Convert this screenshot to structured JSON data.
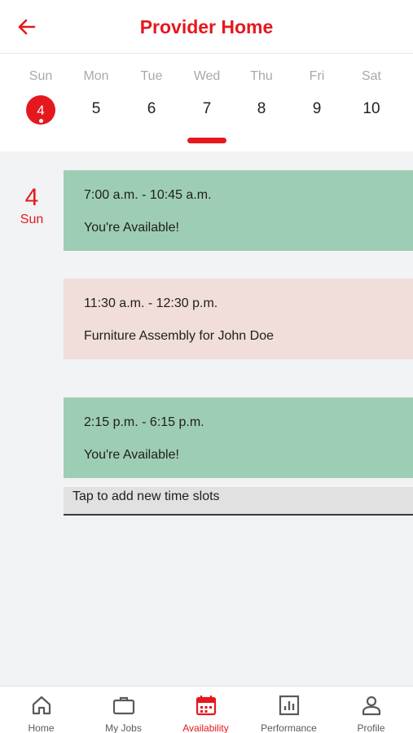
{
  "header": {
    "title": "Provider Home",
    "back_icon": "arrow-left-icon"
  },
  "week": {
    "days": [
      {
        "name": "Sun",
        "num": "4"
      },
      {
        "name": "Mon",
        "num": "5"
      },
      {
        "name": "Tue",
        "num": "6"
      },
      {
        "name": "Wed",
        "num": "7"
      },
      {
        "name": "Thu",
        "num": "8"
      },
      {
        "name": "Fri",
        "num": "9"
      },
      {
        "name": "Sat",
        "num": "10"
      }
    ],
    "selected_day": "Sun",
    "underlined_day": "Wed"
  },
  "schedule": {
    "date_num": "4",
    "date_day": "Sun",
    "slots": [
      {
        "time": "7:00 a.m. - 10:45 a.m.",
        "desc": "You're Available!",
        "status": "available"
      },
      {
        "time": "11:30 a.m. - 12:30 p.m.",
        "desc": "Furniture Assembly for John Doe",
        "status": "booked"
      },
      {
        "time": "2:15 p.m. - 6:15 p.m.",
        "desc": "You're Available!",
        "status": "available"
      }
    ],
    "add_label": "Tap to add new time slots"
  },
  "tabs": [
    {
      "label": "Home",
      "icon": "home-icon"
    },
    {
      "label": "My Jobs",
      "icon": "briefcase-icon"
    },
    {
      "label": "Availability",
      "icon": "calendar-icon",
      "active": true
    },
    {
      "label": "Performance",
      "icon": "chart-icon"
    },
    {
      "label": "Profile",
      "icon": "person-icon"
    }
  ],
  "colors": {
    "accent": "#e5181d",
    "available": "#9ecdb5",
    "booked": "#f1ddd9"
  }
}
